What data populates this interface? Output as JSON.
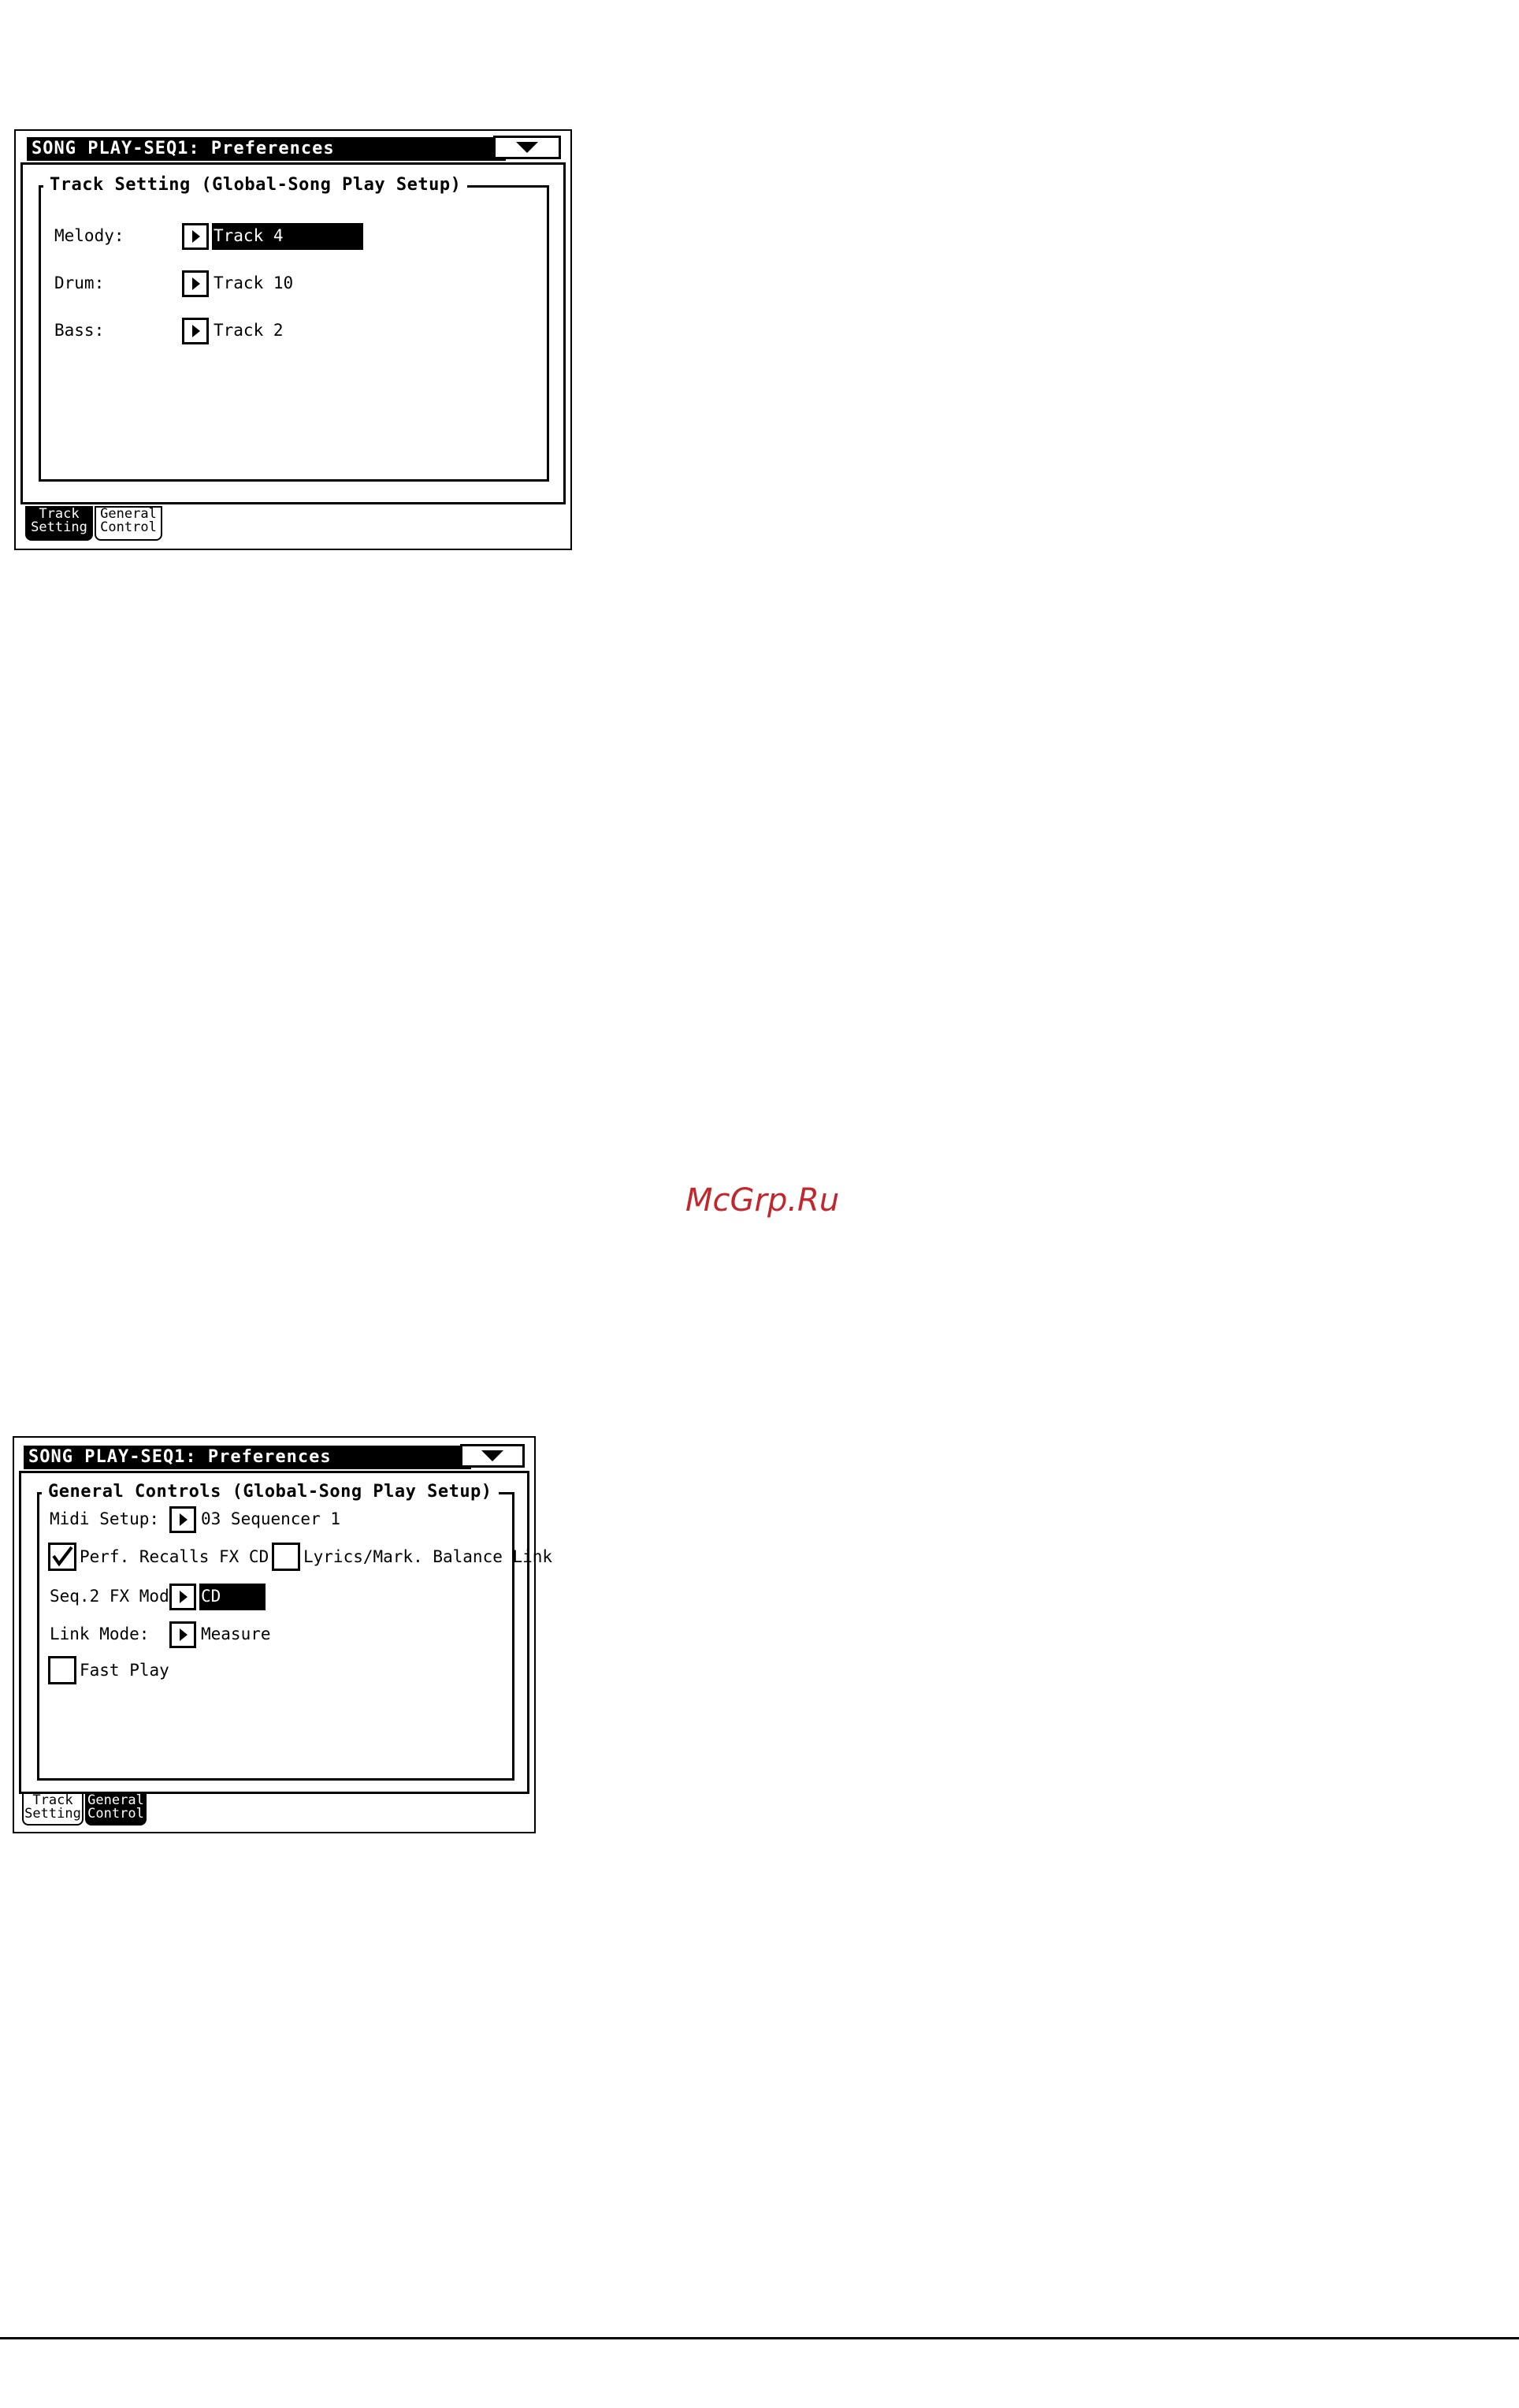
{
  "screen1": {
    "title": "SONG PLAY-SEQ1: Preferences",
    "group_title": "Track Setting (Global-Song Play Setup)",
    "rows": [
      {
        "label": "Melody:",
        "value": "Track 4"
      },
      {
        "label": "Drum:",
        "value": "Track 10"
      },
      {
        "label": "Bass:",
        "value": "Track 2"
      }
    ],
    "tabs": [
      {
        "line1": "Track",
        "line2": "Setting"
      },
      {
        "line1": "General",
        "line2": "Control"
      }
    ],
    "active_tab": 0
  },
  "screen2": {
    "title": "SONG PLAY-SEQ1: Preferences",
    "group_title": "General Controls (Global-Song Play Setup)",
    "midi_setup": {
      "label": "Midi Setup:",
      "value": "03 Sequencer 1"
    },
    "perf_recalls": {
      "label": "Perf. Recalls FX CD",
      "checked": true
    },
    "lyrics_link": {
      "label": "Lyrics/Mark. Balance Link",
      "checked": false
    },
    "seq2_fx_mode": {
      "label": "Seq.2 FX Mode:",
      "value": "CD"
    },
    "link_mode": {
      "label": "Link Mode:",
      "value": "Measure"
    },
    "fast_play": {
      "label": "Fast Play",
      "checked": false
    },
    "tabs": [
      {
        "line1": "Track",
        "line2": "Setting"
      },
      {
        "line1": "General",
        "line2": "Control"
      }
    ],
    "active_tab": 1
  },
  "watermark": "McGrp.Ru"
}
